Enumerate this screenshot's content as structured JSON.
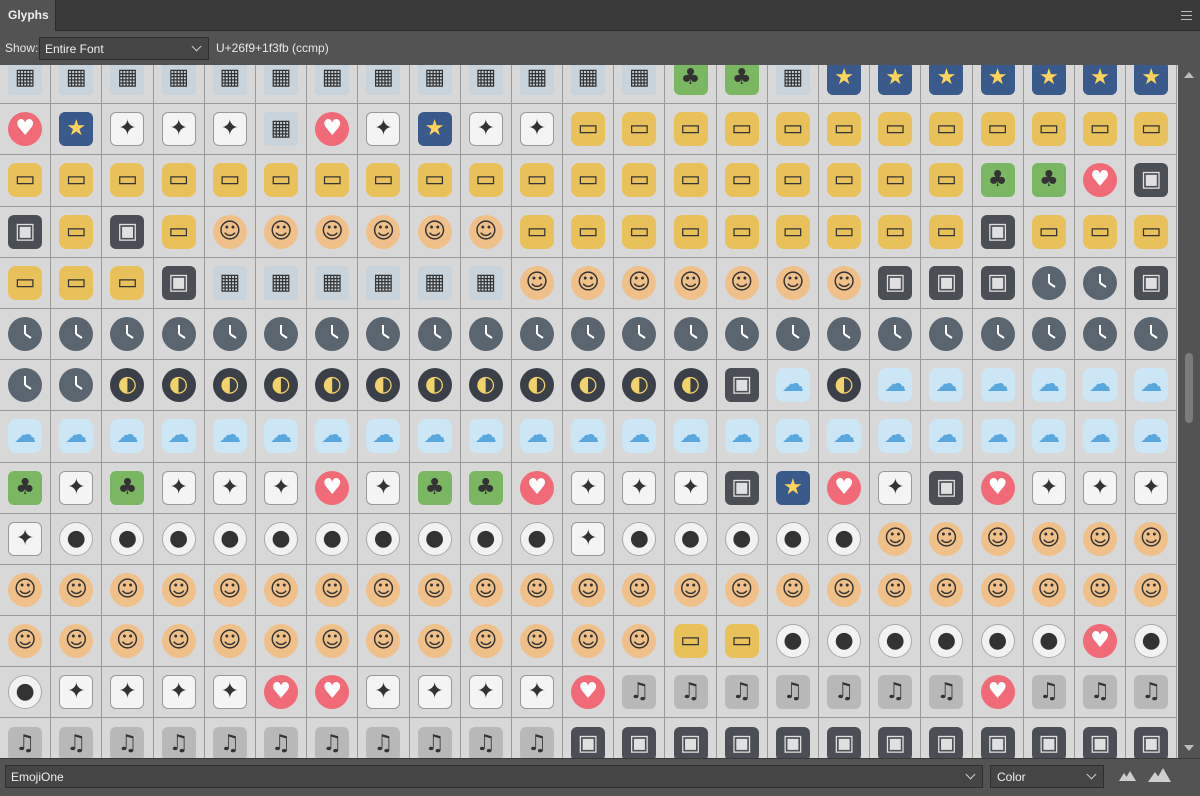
{
  "panel": {
    "title": "Glyphs"
  },
  "show": {
    "label": "Show:",
    "value": "Entire Font",
    "codepoint": "U+26f9+1f3fb (ccmp)"
  },
  "footer": {
    "font_family": "EmojiOne",
    "font_style": "Color"
  },
  "icon_key": {
    "b": "building-icon",
    "v": "vehicle-icon",
    "p": "person-icon",
    "c": "clock-icon",
    "m": "moon-phase-icon",
    "w": "weather-icon",
    "s": "sport-icon",
    "k": "sky-scene-icon",
    "g": "game-icon",
    "u": "music-icon",
    "d": "device-icon",
    "r": "red-symbol-icon",
    "n": "nature-icon"
  },
  "glyph_rows": [
    [
      "b",
      "b",
      "b",
      "b",
      "b",
      "b",
      "b",
      "b",
      "b",
      "b",
      "b",
      "b",
      "b",
      "n",
      "n",
      "b",
      "k",
      "k",
      "k",
      "k",
      "k",
      "k",
      "k"
    ],
    [
      "r",
      "k",
      "g",
      "g",
      "g",
      "b",
      "r",
      "g",
      "k",
      "g",
      "g",
      "v",
      "v",
      "v",
      "v",
      "v",
      "v",
      "v",
      "v",
      "v",
      "v",
      "v",
      "v"
    ],
    [
      "v",
      "v",
      "v",
      "v",
      "v",
      "v",
      "v",
      "v",
      "v",
      "v",
      "v",
      "v",
      "v",
      "v",
      "v",
      "v",
      "v",
      "v",
      "v",
      "n",
      "n",
      "r",
      "d"
    ],
    [
      "d",
      "v",
      "d",
      "v",
      "p",
      "p",
      "p",
      "p",
      "p",
      "p",
      "v",
      "v",
      "v",
      "v",
      "v",
      "v",
      "v",
      "v",
      "v",
      "d",
      "v",
      "v",
      "v"
    ],
    [
      "v",
      "v",
      "v",
      "d",
      "b",
      "b",
      "b",
      "b",
      "b",
      "b",
      "p",
      "p",
      "p",
      "p",
      "p",
      "p",
      "p",
      "d",
      "d",
      "d",
      "c",
      "c",
      "d"
    ],
    [
      "c",
      "c",
      "c",
      "c",
      "c",
      "c",
      "c",
      "c",
      "c",
      "c",
      "c",
      "c",
      "c",
      "c",
      "c",
      "c",
      "c",
      "c",
      "c",
      "c",
      "c",
      "c",
      "c"
    ],
    [
      "c",
      "c",
      "m",
      "m",
      "m",
      "m",
      "m",
      "m",
      "m",
      "m",
      "m",
      "m",
      "m",
      "m",
      "d",
      "w",
      "m",
      "w",
      "w",
      "w",
      "w",
      "w",
      "w"
    ],
    [
      "w",
      "w",
      "w",
      "w",
      "w",
      "w",
      "w",
      "w",
      "w",
      "w",
      "w",
      "w",
      "w",
      "w",
      "w",
      "w",
      "w",
      "w",
      "w",
      "w",
      "w",
      "w",
      "w"
    ],
    [
      "n",
      "g",
      "n",
      "g",
      "g",
      "g",
      "r",
      "g",
      "n",
      "n",
      "r",
      "g",
      "g",
      "g",
      "d",
      "k",
      "r",
      "g",
      "d",
      "r",
      "g",
      "g",
      "g"
    ],
    [
      "g",
      "s",
      "s",
      "s",
      "s",
      "s",
      "s",
      "s",
      "s",
      "s",
      "s",
      "g",
      "s",
      "s",
      "s",
      "s",
      "s",
      "p",
      "p",
      "p",
      "p",
      "p",
      "p"
    ],
    [
      "p",
      "p",
      "p",
      "p",
      "p",
      "p",
      "p",
      "p",
      "p",
      "p",
      "p",
      "p",
      "p",
      "p",
      "p",
      "p",
      "p",
      "p",
      "p",
      "p",
      "p",
      "p",
      "p"
    ],
    [
      "p",
      "p",
      "p",
      "p",
      "p",
      "p",
      "p",
      "p",
      "p",
      "p",
      "p",
      "p",
      "p",
      "v",
      "v",
      "s",
      "s",
      "s",
      "s",
      "s",
      "s",
      "r",
      "s"
    ],
    [
      "s",
      "g",
      "g",
      "g",
      "g",
      "r",
      "r",
      "g",
      "g",
      "g",
      "g",
      "r",
      "u",
      "u",
      "u",
      "u",
      "u",
      "u",
      "u",
      "r",
      "u",
      "u",
      "u"
    ],
    [
      "u",
      "u",
      "u",
      "u",
      "u",
      "u",
      "u",
      "u",
      "u",
      "u",
      "u",
      "d",
      "d",
      "d",
      "d",
      "d",
      "d",
      "d",
      "d",
      "d",
      "d",
      "d",
      "d"
    ]
  ]
}
